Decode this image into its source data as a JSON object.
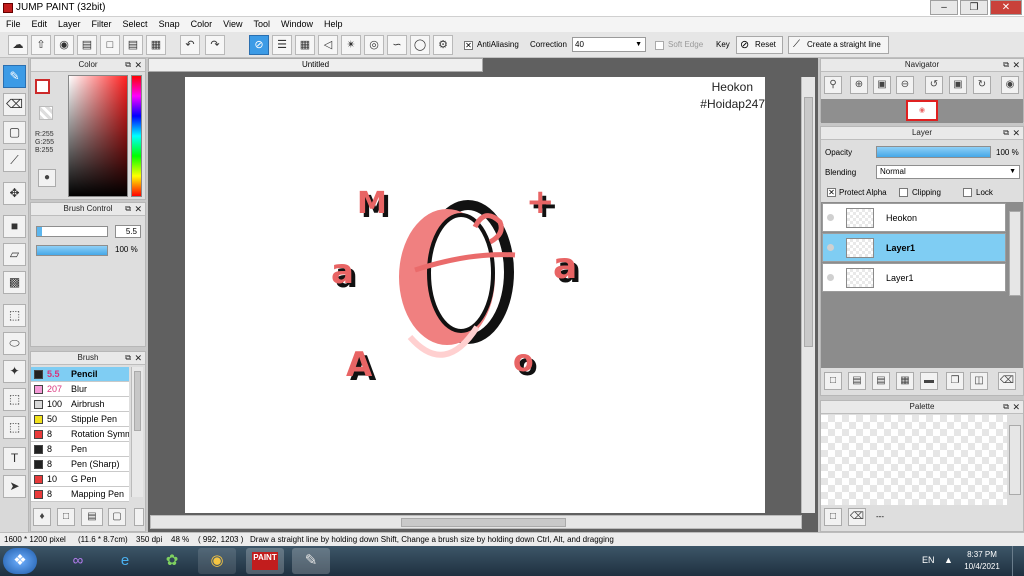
{
  "window": {
    "title": "JUMP PAINT (32bit)"
  },
  "menu": [
    "File",
    "Edit",
    "Layer",
    "Filter",
    "Select",
    "Snap",
    "Color",
    "View",
    "Tool",
    "Window",
    "Help"
  ],
  "toolbar": {
    "antialiasing_label": "AntiAliasing",
    "correction_label": "Correction",
    "correction_value": "40",
    "soft_edge_label": "Soft Edge",
    "key_label": "Key",
    "reset_label": "Reset",
    "straight_line_label": "Create a straight line"
  },
  "color_panel": {
    "title": "Color",
    "r": "R:255",
    "g": "G:255",
    "b": "B:255",
    "colors": {
      "primary": "#cc2a2a",
      "accent": "#3c9be6"
    }
  },
  "brush_control": {
    "title": "Brush Control",
    "size_value": "5.5",
    "opacity_value": "100 %"
  },
  "brush_panel": {
    "title": "Brush",
    "items": [
      {
        "size": "5.5",
        "name": "Pencil",
        "color": "#222222",
        "selected": true
      },
      {
        "size": "207",
        "name": "Blur",
        "color": "#f59ad7",
        "selected": false
      },
      {
        "size": "100",
        "name": "Airbrush",
        "color": "#d9d9d9",
        "selected": false
      },
      {
        "size": "50",
        "name": "Stipple Pen",
        "color": "#f2e11b",
        "selected": false
      },
      {
        "size": "8",
        "name": "Rotation Symm",
        "color": "#e83a3a",
        "selected": false
      },
      {
        "size": "8",
        "name": "Pen",
        "color": "#222222",
        "selected": false
      },
      {
        "size": "8",
        "name": "Pen (Sharp)",
        "color": "#222222",
        "selected": false
      },
      {
        "size": "10",
        "name": "G Pen",
        "color": "#e83a3a",
        "selected": false
      },
      {
        "size": "8",
        "name": "Mapping Pen",
        "color": "#e83a3a",
        "selected": false
      }
    ]
  },
  "document": {
    "tab_title": "Untitled",
    "watermark_line1": "Heokon",
    "watermark_line2": "#Hoidap247"
  },
  "navigator": {
    "title": "Navigator"
  },
  "layer_panel": {
    "title": "Layer",
    "opacity_label": "Opacity",
    "opacity_value": "100 %",
    "blending_label": "Blending",
    "blending_value": "Normal",
    "protect_alpha_label": "Protect Alpha",
    "clipping_label": "Clipping",
    "lock_label": "Lock",
    "layers": [
      {
        "name": "Heokon",
        "selected": false
      },
      {
        "name": "Layer1",
        "selected": true
      },
      {
        "name": "Layer1",
        "selected": false
      }
    ]
  },
  "palette_panel": {
    "title": "Palette",
    "dots": "---"
  },
  "statusbar": {
    "size": "1600 * 1200 pixel",
    "physical": "(11.6 * 8.7cm)",
    "dpi": "350 dpi",
    "zoom": "48 %",
    "coords": "( 992, 1203 )",
    "hint": "Draw a straight line by holding down Shift, Change a brush size by holding down Ctrl, Alt, and dragging"
  },
  "taskbar": {
    "lang": "EN",
    "time": "8:37 PM",
    "date": "10/4/2021"
  }
}
